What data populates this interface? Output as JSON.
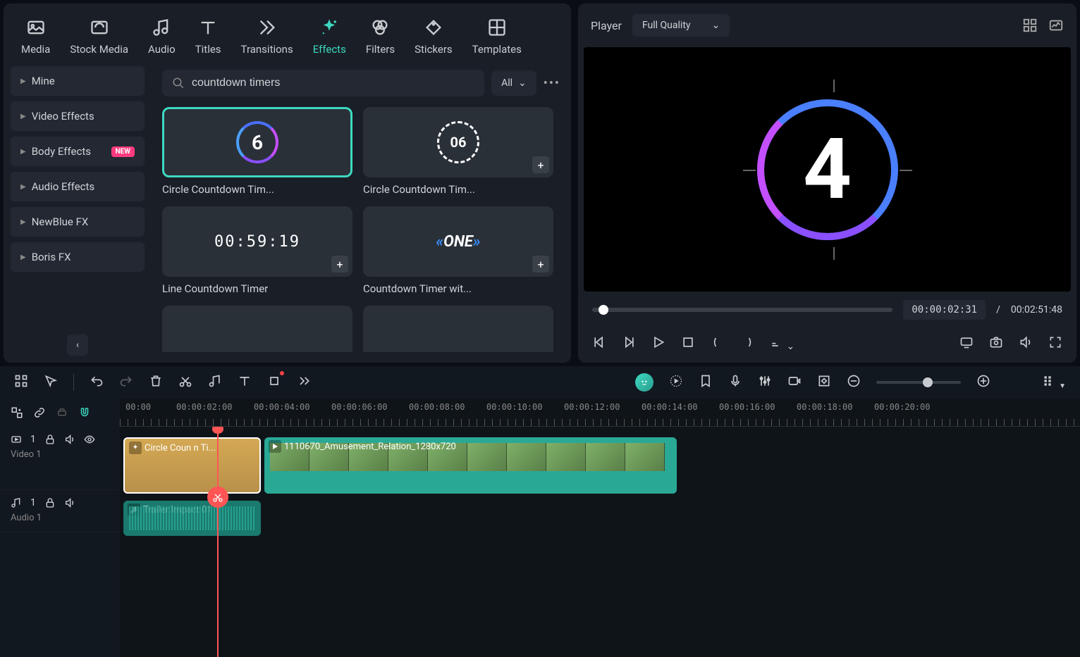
{
  "mediaTabs": {
    "media": "Media",
    "stockMedia": "Stock Media",
    "audio": "Audio",
    "titles": "Titles",
    "transitions": "Transitions",
    "effects": "Effects",
    "filters": "Filters",
    "stickers": "Stickers",
    "templates": "Templates"
  },
  "sidebar": {
    "items": [
      {
        "label": "Mine"
      },
      {
        "label": "Video Effects"
      },
      {
        "label": "Body Effects",
        "badge": "NEW"
      },
      {
        "label": "Audio Effects"
      },
      {
        "label": "NewBlue FX"
      },
      {
        "label": "Boris FX"
      }
    ]
  },
  "search": {
    "value": "countdown timers",
    "filter": "All"
  },
  "effects": [
    {
      "label": "Circle Countdown Tim...",
      "num": "6"
    },
    {
      "label": "Circle Countdown Tim...",
      "num": "06"
    },
    {
      "label": "Line Countdown Timer",
      "time": "00:59:19"
    },
    {
      "label": "Countdown Timer wit...",
      "text": "ONE"
    }
  ],
  "player": {
    "label": "Player",
    "quality": "Full Quality",
    "previewNum": "4",
    "currentTime": "00:00:02:31",
    "separator": "/",
    "totalTime": "00:02:51:48"
  },
  "ruler": {
    "marks": [
      "00:00",
      "00:00:02:00",
      "00:00:04:00",
      "00:00:06:00",
      "00:00:08:00",
      "00:00:10:00",
      "00:00:12:00",
      "00:00:14:00",
      "00:00:16:00",
      "00:00:18:00",
      "00:00:20:00"
    ]
  },
  "tracks": {
    "video1": {
      "name": "Video 1",
      "num": "1"
    },
    "audio1": {
      "name": "Audio 1",
      "num": "1"
    },
    "clip1": "Circle Coun",
    "clip1b": "n Ti...",
    "clip2": "1110670_Amusement_Relation_1280x720",
    "clip3": "Trailer Impact 01"
  }
}
